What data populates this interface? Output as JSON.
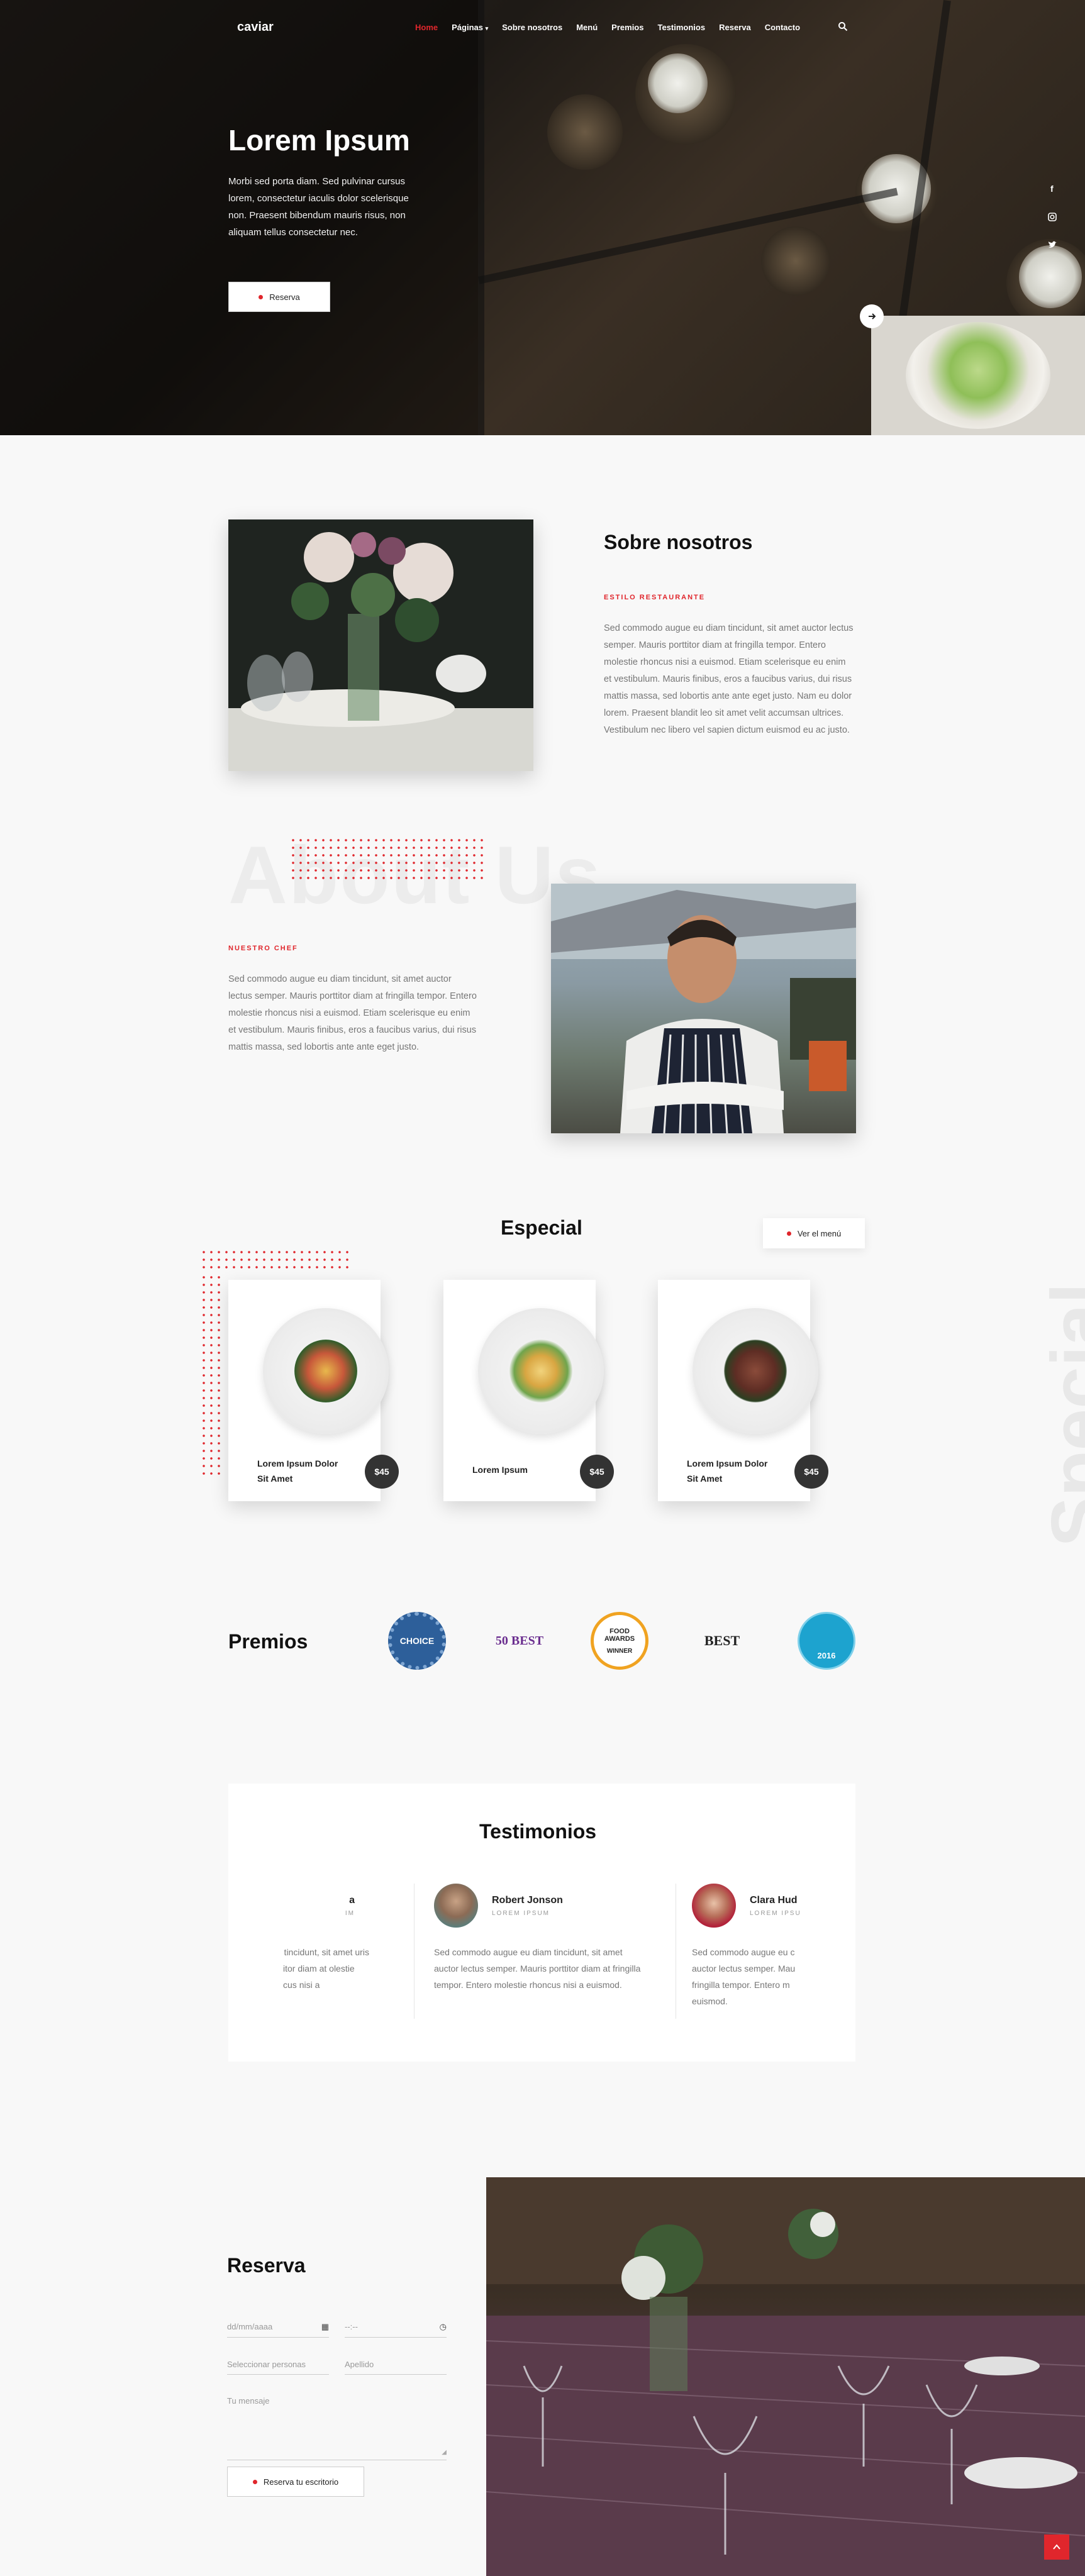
{
  "brand": "caviar",
  "nav": [
    "Home",
    "Páginas",
    "Sobre nosotros",
    "Menú",
    "Premios",
    "Testimonios",
    "Reserva",
    "Contacto"
  ],
  "hero": {
    "title": "Lorem Ipsum",
    "text": "Morbi sed porta diam. Sed pulvinar cursus lorem, consectetur iaculis dolor scelerisque non. Praesent bibendum mauris risus, non aliquam tellus consectetur nec.",
    "button": "Reserva"
  },
  "social": [
    "facebook-icon",
    "instagram-icon",
    "twitter-icon"
  ],
  "about": {
    "title": "Sobre nosotros",
    "eyebrow": "ESTILO RESTAURANTE",
    "text": "Sed commodo augue eu diam tincidunt, sit amet auctor lectus semper. Mauris porttitor diam at fringilla tempor. Entero molestie rhoncus nisi a euismod. Etiam scelerisque eu enim et vestibulum. Mauris finibus, eros a faucibus varius, dui risus mattis massa, sed lobortis ante ante eget justo. Nam eu dolor lorem. Praesent blandit leo sit amet velit accumsan ultrices. Vestibulum nec libero vel sapien dictum euismod eu ac justo.",
    "ghost": "About Us"
  },
  "chef": {
    "eyebrow": "NUESTRO CHEF",
    "text": "Sed commodo augue eu diam tincidunt, sit amet auctor lectus semper. Mauris porttitor diam at fringilla tempor. Entero molestie rhoncus nisi a euismod. Etiam scelerisque eu enim et vestibulum. Mauris finibus, eros a faucibus varius, dui risus mattis massa, sed lobortis ante ante eget justo."
  },
  "special": {
    "title": "Especial",
    "menu_button": "Ver el menú",
    "ghost": "Special",
    "items": [
      {
        "name": "Lorem Ipsum Dolor Sit Amet",
        "price": "$45"
      },
      {
        "name": "Lorem Ipsum",
        "price": "$45"
      },
      {
        "name": "Lorem Ipsum Dolor Sit Amet",
        "price": "$45"
      }
    ]
  },
  "awards": {
    "title": "Premios",
    "badges": [
      {
        "label": "CHOICE"
      },
      {
        "label": "50 BEST"
      },
      {
        "label": "FOOD AWARDS",
        "sub": "WINNER"
      },
      {
        "label": "BEST"
      },
      {
        "label": "2016"
      }
    ]
  },
  "testimonials": {
    "title": "Testimonios",
    "items": [
      {
        "name": "a",
        "role": "IM",
        "text": "ilam tincidunt, sit amet uris porttitor diam at olestie rhoncus nisi a"
      },
      {
        "name": "Robert Jonson",
        "role": "LOREM IPSUM",
        "text": "Sed commodo augue eu diam tincidunt, sit amet auctor lectus semper. Mauris porttitor diam at fringilla tempor. Entero molestie rhoncus nisi a euismod."
      },
      {
        "name": "Clara Hud",
        "role": "LOREM IPSU",
        "text": "Sed commodo augue eu c auctor lectus semper. Mau fringilla tempor. Entero m euismod."
      }
    ]
  },
  "reserva": {
    "title": "Reserva",
    "date_placeholder": "dd/mm/aaaa",
    "time_placeholder": "--:--",
    "persons_placeholder": "Seleccionar personas",
    "surname_placeholder": "Apellido",
    "message_placeholder": "Tu mensaje",
    "button": "Reserva tu escritorio"
  }
}
